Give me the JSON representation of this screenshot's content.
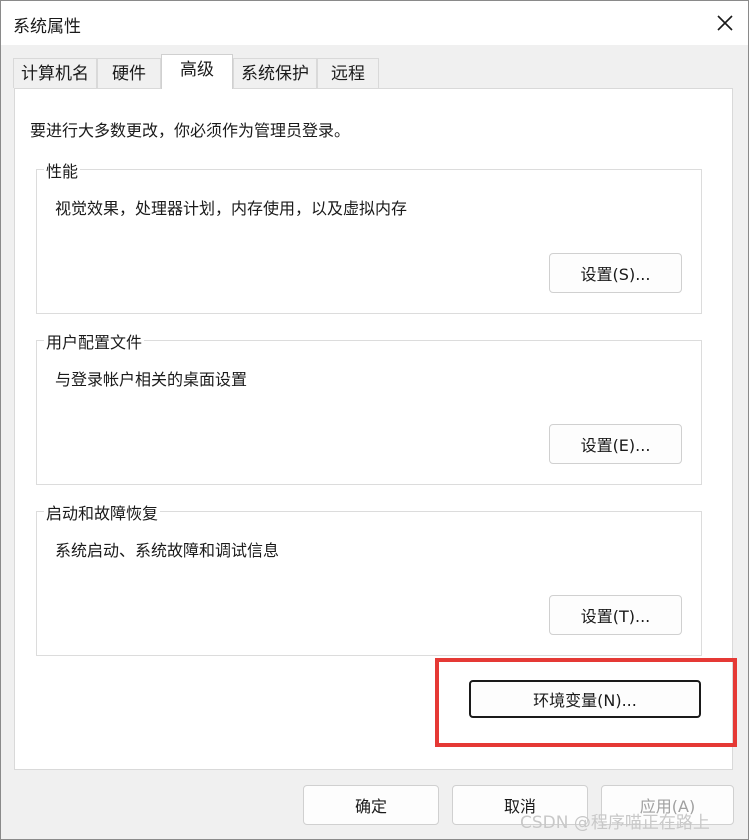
{
  "window": {
    "title": "系统属性"
  },
  "tabs": [
    {
      "label": "计算机名"
    },
    {
      "label": "硬件"
    },
    {
      "label": "高级"
    },
    {
      "label": "系统保护"
    },
    {
      "label": "远程"
    }
  ],
  "active_tab": "高级",
  "notice": "要进行大多数更改，你必须作为管理员登录。",
  "groups": {
    "performance": {
      "title": "性能",
      "desc": "视觉效果，处理器计划，内存使用，以及虚拟内存",
      "button": "设置(S)..."
    },
    "profiles": {
      "title": "用户配置文件",
      "desc": "与登录帐户相关的桌面设置",
      "button": "设置(E)..."
    },
    "startup": {
      "title": "启动和故障恢复",
      "desc": "系统启动、系统故障和调试信息",
      "button": "设置(T)..."
    }
  },
  "env_button": "环境变量(N)...",
  "footer": {
    "ok": "确定",
    "cancel": "取消",
    "apply": "应用(A)"
  },
  "watermark": "CSDN @程序喵正在路上",
  "colors": {
    "highlight": "#e53935",
    "panel": "#ffffff",
    "background": "#f0f0f0"
  }
}
